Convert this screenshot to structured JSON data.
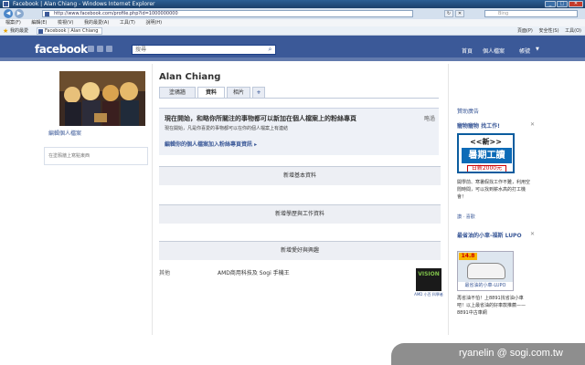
{
  "window": {
    "title": "Facebook | Alan Chiang - Windows Internet Explorer",
    "url": "http://www.facebook.com/profile.php?id=1000000000",
    "search_placeholder": "Bing"
  },
  "ie_menu": [
    "檔案(F)",
    "編輯(E)",
    "檢視(V)",
    "我的最愛(A)",
    "工具(T)",
    "說明(H)"
  ],
  "favorites": {
    "label": "我的最愛",
    "tab": "Facebook | Alan Chiang",
    "tools": [
      "頁面(P)",
      "安全性(S)",
      "工具(O)"
    ]
  },
  "facebook": {
    "logo": "facebook",
    "search_placeholder": "搜尋",
    "nav": {
      "home": "首頁",
      "profile": "個人檔案",
      "account": "帳號"
    }
  },
  "profile": {
    "name": "Alan Chiang",
    "edit_link": "編輯個人檔案",
    "left_box": "在塗鴉牆上寫點東西",
    "tabs": [
      {
        "label": "塗鴉牆",
        "active": false
      },
      {
        "label": "資料",
        "active": true
      },
      {
        "label": "相片",
        "active": false
      },
      {
        "label": "+",
        "active": false
      }
    ]
  },
  "notice": {
    "heading": "現在開始，和略你所關注的事物都可以新加在個人檔案上的粉絲專頁",
    "subtext": "現在開始，凡是你喜愛的事物都可以在你的個人檔案上有連結",
    "link": "編輯你的個人檔案加入粉絲專頁資訊 ▸",
    "close": "略過"
  },
  "sections": [
    {
      "label": "新增基本資料"
    },
    {
      "label": "新增學歷與工作資料"
    },
    {
      "label": "新增愛好與興趣"
    }
  ],
  "other": {
    "label": "其他",
    "value": "AMD商用科技及 Sogi 手機王",
    "ad_text": "VISION",
    "ad_caption": "AMD 小百 科學者"
  },
  "sidebar": {
    "header": "贊助廣告",
    "ad1": {
      "title": "寵物寵物 找工作!",
      "close": "✕",
      "img_top": "<<新>>",
      "img_main": "暑期工讀",
      "img_price": "日薪2000元",
      "desc": "開學前、寒暑假找工作不難，利用空閒時間，可以找到薪水高的打工機會！",
      "like": "讚 · 喜歡"
    },
    "ad2": {
      "title": "最省油的小車-福斯 LUPO",
      "close": "✕",
      "badge": "14.8",
      "img_caption": "最省油的小車-LUPO",
      "desc": "再省油不怕！上8891找省油小車吧！以上最省油的好車款推薦——8891中古車網"
    }
  },
  "watermark": {
    "text": "ryanelin  @ sogi.com.tw"
  }
}
